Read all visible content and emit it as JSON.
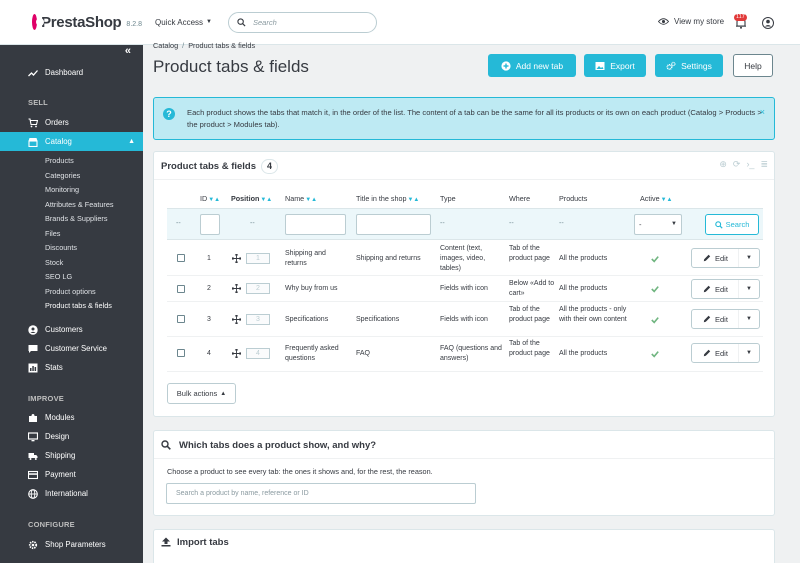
{
  "header": {
    "brand": "PrestaShop",
    "version": "8.2.8",
    "quick_access": "Quick Access",
    "search_placeholder": "Search",
    "view_store": "View my store",
    "notifications_count": "117"
  },
  "sidebar": {
    "dashboard": "Dashboard",
    "section_sell": "SELL",
    "orders": "Orders",
    "catalog": "Catalog",
    "catalog_sub": [
      "Products",
      "Categories",
      "Monitoring",
      "Attributes & Features",
      "Brands & Suppliers",
      "Files",
      "Discounts",
      "Stock",
      "SEO LG",
      "Product options",
      "Product tabs & fields"
    ],
    "customers": "Customers",
    "customer_service": "Customer Service",
    "stats": "Stats",
    "section_improve": "IMPROVE",
    "modules": "Modules",
    "design": "Design",
    "shipping": "Shipping",
    "payment": "Payment",
    "international": "International",
    "section_configure": "CONFIGURE",
    "shop_parameters": "Shop Parameters"
  },
  "breadcrumb": {
    "parent": "Catalog",
    "separator": "/",
    "current": "Product tabs & fields"
  },
  "page_title": "Product tabs & fields",
  "toolbar": {
    "add": "Add new tab",
    "export": "Export",
    "settings": "Settings",
    "help": "Help"
  },
  "alert": {
    "text": "Each product shows the tabs that match it, in the order of the list. The content of a tab can be the same for all its products or its own on each product (Catalog > Products > the product > Modules tab).",
    "close": "×"
  },
  "list_panel": {
    "title": "Product tabs & fields",
    "count": "4",
    "columns": {
      "id": "ID",
      "position": "Position",
      "name": "Name",
      "title": "Title in the shop",
      "type": "Type",
      "where": "Where",
      "products": "Products",
      "active": "Active"
    },
    "filter": {
      "dash": "--",
      "active_select": "-",
      "search_button": "Search"
    },
    "rows": [
      {
        "id": "1",
        "position": "1",
        "name": "Shipping and returns",
        "title": "Shipping and returns",
        "type": "Content (text, images, video, tables)",
        "where": "Tab of the product page",
        "products": "All the products",
        "active": true,
        "action": "Edit"
      },
      {
        "id": "2",
        "position": "2",
        "name": "Why buy from us",
        "title": "",
        "type": "Fields with icon",
        "where": "Below «Add to cart»",
        "products": "All the products",
        "active": true,
        "action": "Edit"
      },
      {
        "id": "3",
        "position": "3",
        "name": "Specifications",
        "title": "Specifications",
        "type": "Fields with icon",
        "where": "Tab of the product page",
        "products": "All the products - only with their own content",
        "active": true,
        "action": "Edit"
      },
      {
        "id": "4",
        "position": "4",
        "name": "Frequently asked questions",
        "title": "FAQ",
        "type": "FAQ (questions and answers)",
        "where": "Tab of the product page",
        "products": "All the products",
        "active": true,
        "action": "Edit"
      }
    ],
    "bulk_actions": "Bulk actions"
  },
  "explain_panel": {
    "title": "Which tabs does a product show, and why?",
    "description": "Choose a product to see every tab: the ones it shows and, for the rest, the reason.",
    "placeholder": "Search a product by name, reference or ID"
  },
  "import_panel": {
    "title": "Import tabs"
  },
  "colors": {
    "accent": "#25b9d7",
    "sidebar": "#363a41",
    "success": "#70b580",
    "brand": "#df0067"
  }
}
